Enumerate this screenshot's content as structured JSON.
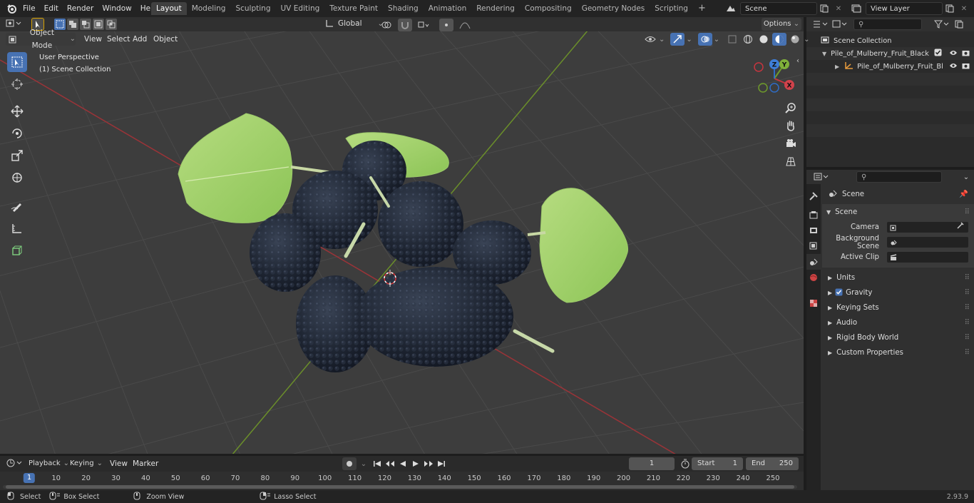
{
  "menu": [
    "File",
    "Edit",
    "Render",
    "Window",
    "Help"
  ],
  "workspaces": [
    "Layout",
    "Modeling",
    "Sculpting",
    "UV Editing",
    "Texture Paint",
    "Shading",
    "Animation",
    "Rendering",
    "Compositing",
    "Geometry Nodes",
    "Scripting"
  ],
  "active_workspace": "Layout",
  "scene_field": "Scene",
  "view_layer_field": "View Layer",
  "header": {
    "transform_orientation": "Global",
    "options": "Options",
    "mode": "Object Mode",
    "view": "View",
    "select": "Select",
    "add": "Add",
    "object": "Object"
  },
  "viewport": {
    "perspective": "User Perspective",
    "collection": "(1) Scene Collection",
    "gizmo": {
      "x": "X",
      "y": "Y",
      "z": "Z"
    }
  },
  "outliner": {
    "root": "Scene Collection",
    "items": [
      {
        "label": "Pile_of_Mulberry_Fruit_Black"
      },
      {
        "label": "Pile_of_Mulberry_Fruit_Bl"
      }
    ]
  },
  "properties": {
    "breadcrumb": "Scene",
    "section": "Scene",
    "fields": [
      {
        "label": "Camera"
      },
      {
        "label": "Background Scene"
      },
      {
        "label": "Active Clip"
      }
    ],
    "panels": [
      "Units",
      "Gravity",
      "Keying Sets",
      "Audio",
      "Rigid Body World",
      "Custom Properties"
    ],
    "gravity_checked": true
  },
  "timeline": {
    "playback": "Playback",
    "keying": "Keying",
    "view": "View",
    "marker": "Marker",
    "current_frame": "1",
    "start_label": "Start",
    "start": "1",
    "end_label": "End",
    "end": "250",
    "ticks": [
      "1",
      "10",
      "20",
      "30",
      "40",
      "50",
      "60",
      "70",
      "80",
      "90",
      "100",
      "110",
      "120",
      "130",
      "140",
      "150",
      "160",
      "170",
      "180",
      "190",
      "200",
      "210",
      "220",
      "230",
      "240",
      "250"
    ]
  },
  "status": {
    "select": "Select",
    "box_select": "Box Select",
    "zoom_view": "Zoom View",
    "lasso_select": "Lasso Select",
    "version": "2.93.9"
  },
  "colors": {
    "accent": "#4772b3",
    "x_axis": "#c6353f",
    "y_axis": "#6e9a2b",
    "z_axis": "#2f6cc6"
  }
}
